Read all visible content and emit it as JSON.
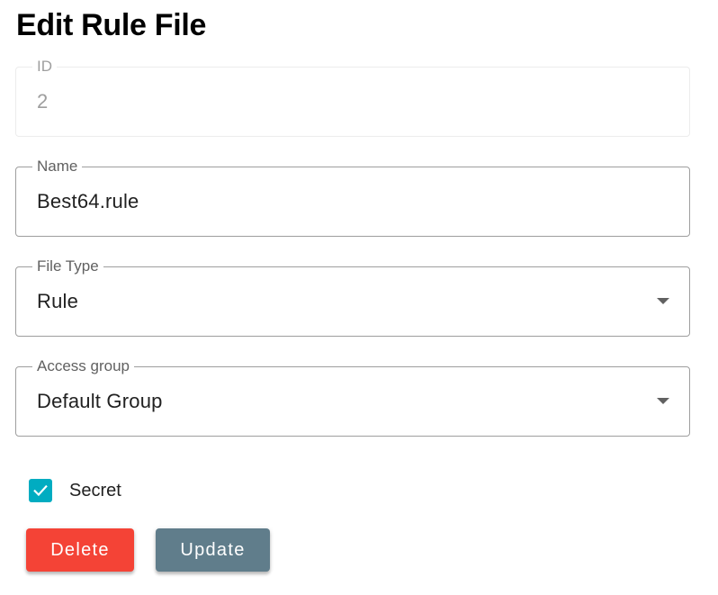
{
  "page": {
    "title": "Edit Rule File"
  },
  "fields": {
    "id": {
      "label": "ID",
      "value": "2"
    },
    "name": {
      "label": "Name",
      "value": "Best64.rule"
    },
    "file_type": {
      "label": "File Type",
      "value": "Rule"
    },
    "access_group": {
      "label": "Access group",
      "value": "Default Group"
    }
  },
  "secret": {
    "label": "Secret",
    "checked": true
  },
  "actions": {
    "delete_label": "Delete",
    "update_label": "Update"
  },
  "colors": {
    "checkbox": "#00acc1",
    "delete": "#f44336",
    "update": "#607d8b"
  },
  "icons": {
    "checkbox": "check-icon",
    "dropdown": "arrow-drop-down-icon"
  }
}
